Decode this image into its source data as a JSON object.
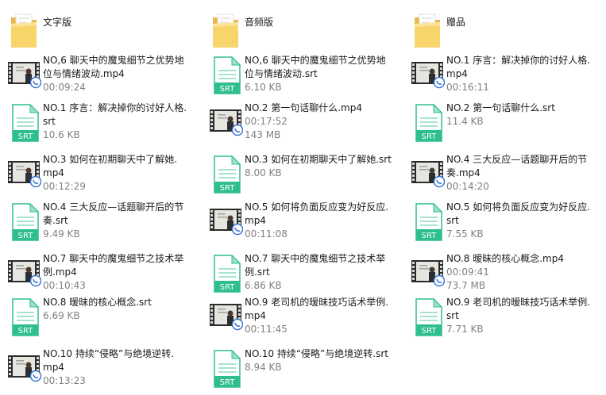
{
  "columns": [
    {
      "items": [
        {
          "type": "folder",
          "name": [
            "文字版"
          ]
        },
        {
          "type": "video",
          "name": [
            "NO,6 聊天中的魔鬼细节之优势地",
            "位与情绪波动.mp4"
          ],
          "meta": [
            "00:09:24"
          ]
        },
        {
          "type": "srt",
          "name": [
            "NO.1 序言：解决掉你的讨好人格.",
            "srt"
          ],
          "meta": [
            "10.6 KB"
          ]
        },
        {
          "type": "video",
          "name": [
            "NO.3 如何在初期聊天中了解她.",
            "mp4"
          ],
          "meta": [
            "00:12:29"
          ]
        },
        {
          "type": "srt",
          "name": [
            "NO.4 三大反应—话题聊开后的节",
            "奏.srt"
          ],
          "meta": [
            "9.49 KB"
          ]
        },
        {
          "type": "video",
          "name": [
            "NO.7 聊天中的魔鬼细节之技术举",
            "例.mp4"
          ],
          "meta": [
            "00:10:43"
          ]
        },
        {
          "type": "srt",
          "name": [
            "NO.8 暧昧的核心概念.srt"
          ],
          "meta": [
            "6.69 KB"
          ]
        },
        {
          "type": "video",
          "name": [
            "NO.10 持续“侵略”与绝境逆转.",
            "mp4"
          ],
          "meta": [
            "00:13:23"
          ]
        }
      ]
    },
    {
      "items": [
        {
          "type": "folder",
          "name": [
            "音频版"
          ]
        },
        {
          "type": "srt",
          "name": [
            "NO,6 聊天中的魔鬼细节之优势地",
            "位与情绪波动.srt"
          ],
          "meta": [
            "6.10 KB"
          ]
        },
        {
          "type": "video",
          "name": [
            "NO.2 第一句话聊什么.mp4"
          ],
          "meta": [
            "00:17:52",
            "143 MB"
          ]
        },
        {
          "type": "srt",
          "name": [
            "NO.3 如何在初期聊天中了解她.srt"
          ],
          "meta": [
            "8.00 KB"
          ]
        },
        {
          "type": "video",
          "name": [
            "NO.5 如何将负面反应变为好反应.",
            "mp4"
          ],
          "meta": [
            "00:11:08"
          ]
        },
        {
          "type": "srt",
          "name": [
            "NO.7 聊天中的魔鬼细节之技术举",
            "例.srt"
          ],
          "meta": [
            "6.86 KB"
          ]
        },
        {
          "type": "video",
          "name": [
            "NO.9 老司机的暧昧技巧话术举例.",
            "mp4"
          ],
          "meta": [
            "00:11:45"
          ]
        },
        {
          "type": "srt",
          "name": [
            "NO.10 持续“侵略”与绝境逆转.srt"
          ],
          "meta": [
            "8.94 KB"
          ]
        }
      ]
    },
    {
      "items": [
        {
          "type": "folder",
          "name": [
            "赠品"
          ]
        },
        {
          "type": "video",
          "name": [
            "NO.1 序言：解决掉你的讨好人格.",
            "mp4"
          ],
          "meta": [
            "00:16:11"
          ]
        },
        {
          "type": "srt",
          "name": [
            "NO.2 第一句话聊什么.srt"
          ],
          "meta": [
            "11.4 KB"
          ]
        },
        {
          "type": "video",
          "name": [
            "NO.4 三大反应—话题聊开后的节",
            "奏.mp4"
          ],
          "meta": [
            "00:14:20"
          ]
        },
        {
          "type": "srt",
          "name": [
            "NO.5 如何将负面反应变为好反应.",
            "srt"
          ],
          "meta": [
            "7.55 KB"
          ]
        },
        {
          "type": "video",
          "name": [
            "NO.8 暧昧的核心概念.mp4"
          ],
          "meta": [
            "00:09:41",
            "73.7 MB"
          ]
        },
        {
          "type": "srt",
          "name": [
            "NO.9 老司机的暧昧技巧话术举例.",
            "srt"
          ],
          "meta": [
            "7.71 KB"
          ]
        }
      ]
    }
  ],
  "srt_icon_label": "SRT",
  "colors": {
    "srt_green": "#2fbf8e",
    "folder": "#f7d56b",
    "text": "#1a1a1a",
    "meta": "#808080"
  }
}
